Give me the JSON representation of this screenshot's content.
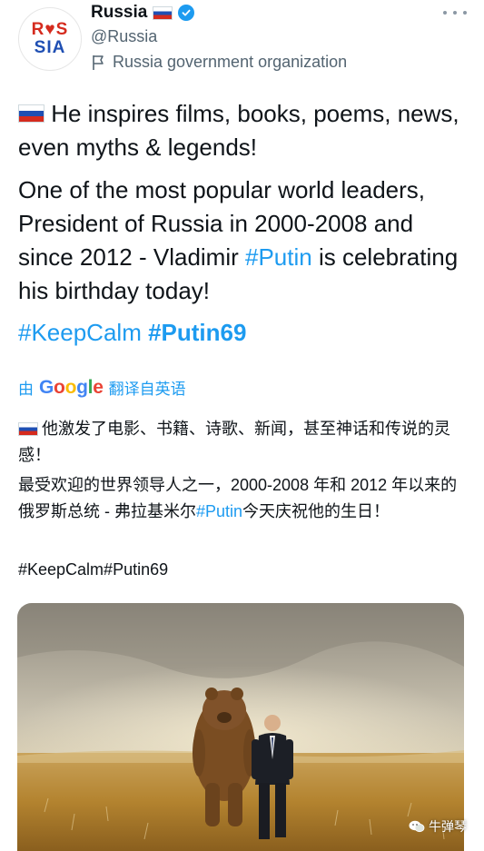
{
  "header": {
    "avatar_text_line1": "R♥S",
    "avatar_text_line2": "SIA",
    "name": "Russia",
    "handle": "@Russia",
    "label": "Russia government organization",
    "flag_icon": "russia-flag-icon",
    "verified_icon": "verified-badge-icon",
    "more_icon": "more-options-icon"
  },
  "tweet": {
    "line1_text": " He inspires films, books, poems, news, even myths & legends!",
    "para2_text": "One of the most popular world leaders, President of Russia in 2000-2008 and since 2012 - Vladimir ",
    "para2_tag": "#Putin",
    "para2_tail": " is celebrating his birthday today!",
    "tag1": "#KeepCalm",
    "tag2": "#Putin69"
  },
  "translation": {
    "prefix": "由",
    "provider": "Google",
    "suffix": "翻译自英语",
    "line1_text": "他激发了电影、书籍、诗歌、新闻，甚至神话和传说的灵感！",
    "para2_text": "最受欢迎的世界领导人之一，2000-2008 年和 2012 年以来的俄罗斯总统 - 弗拉基米尔",
    "para2_tag": "#Putin",
    "para2_tail": "今天庆祝他的生日！",
    "tags": "#KeepCalm#Putin69"
  },
  "watermark": {
    "text": "牛弹琴",
    "icon": "wechat-icon"
  },
  "colors": {
    "link": "#1d9bf0",
    "text": "#0f1419",
    "muted": "#536471"
  }
}
